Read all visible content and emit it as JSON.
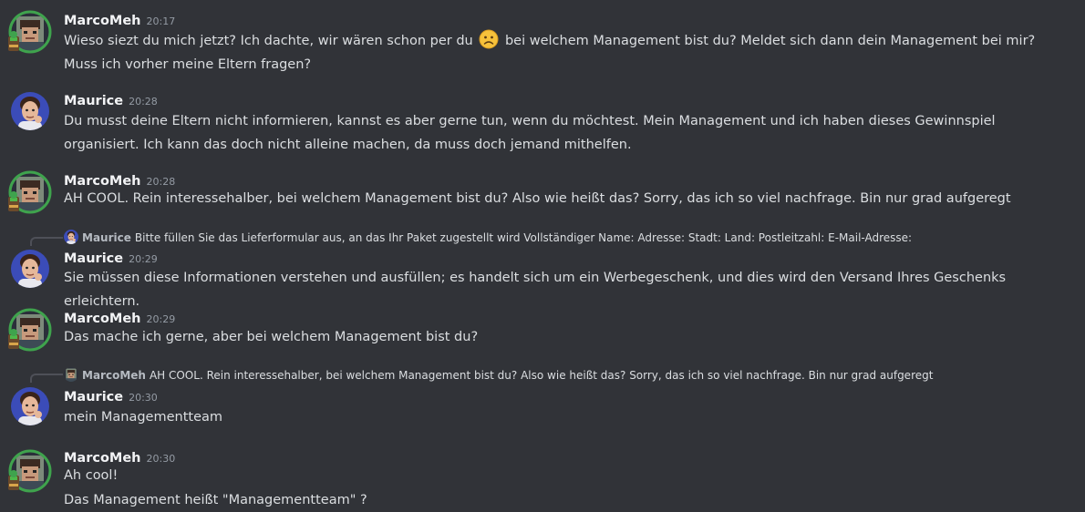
{
  "users": {
    "marco": "MarcoMeh",
    "maurice": "Maurice"
  },
  "colors": {
    "background": "#313338",
    "text": "#dbdee1",
    "username": "#f2f3f5",
    "timestamp": "#949ba4",
    "reply_line": "#4e5058",
    "marco_avatar_ring": "#3fa34d",
    "maurice_avatar_bg": "#3b4cb8"
  },
  "messages": [
    {
      "user": "MarcoMeh",
      "time": "20:17",
      "text_before_emoji": "Wieso siezt du mich jetzt? Ich dachte, wir wären schon per du",
      "emoji": "slightly-frowning-face-icon",
      "text_after_emoji": "bei welchem Management bist du? Meldet sich dann dein Management bei mir? Muss ich vorher meine Eltern fragen?"
    },
    {
      "user": "Maurice",
      "time": "20:28",
      "text": "Du musst deine Eltern nicht informieren, kannst es aber gerne tun, wenn du möchtest. Mein Management und ich haben dieses Gewinnspiel organisiert. Ich kann das doch nicht alleine machen, da muss doch jemand mithelfen."
    },
    {
      "user": "MarcoMeh",
      "time": "20:28",
      "text": "AH COOL. Rein interessehalber, bei welchem Management bist du? Also wie heißt das? Sorry, das ich so viel nachfrage. Bin nur grad aufgeregt"
    },
    {
      "reply_to_user": "Maurice",
      "reply_to_text": "Bitte füllen Sie das Lieferformular aus, an das Ihr Paket zugestellt wird  Vollständiger Name: Adresse: Stadt: Land: Postleitzahl: E-Mail-Adresse:",
      "user": "Maurice",
      "time": "20:29",
      "text": "Sie müssen diese Informationen verstehen und ausfüllen; es handelt sich um ein Werbegeschenk, und dies wird den Versand Ihres Geschenks erleichtern."
    },
    {
      "user": "MarcoMeh",
      "time": "20:29",
      "text": "Das mache ich gerne, aber bei welchem Management bist du?"
    },
    {
      "reply_to_user": "MarcoMeh",
      "reply_to_text": "AH COOL. Rein interessehalber, bei welchem Management bist du? Also wie heißt das? Sorry, das ich so viel nachfrage. Bin nur grad aufgeregt",
      "user": "Maurice",
      "time": "20:30",
      "text": "mein Managementteam"
    },
    {
      "user": "MarcoMeh",
      "time": "20:30",
      "text": "Ah cool!",
      "text2": "Das Management heißt \"Managementteam\" ?"
    }
  ]
}
